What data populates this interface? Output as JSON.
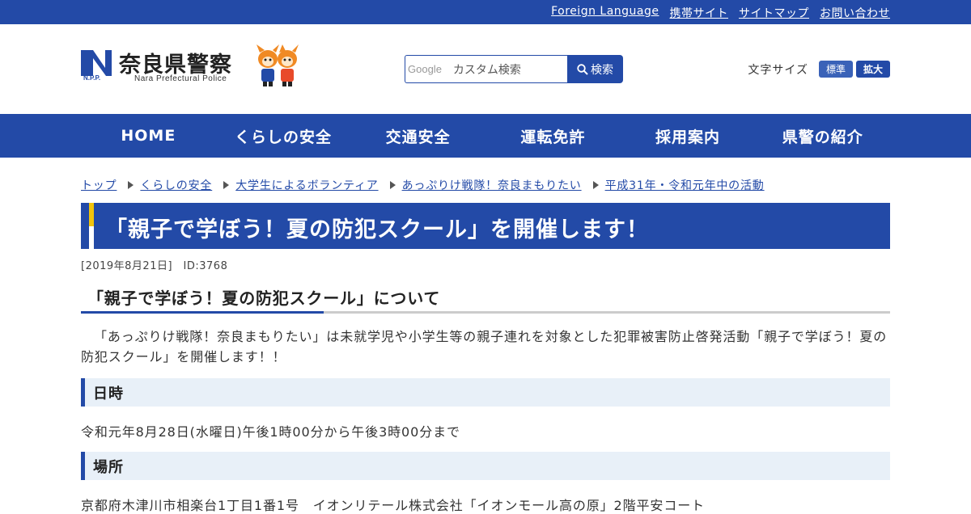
{
  "topbar": {
    "links": [
      "Foreign Language",
      "携帯サイト",
      "サイトマップ",
      "お問い合わせ"
    ]
  },
  "header": {
    "logo_title": "奈良県警察",
    "logo_sub": "Nara Prefectural Police",
    "logo_abbr": "N.P.P.",
    "search": {
      "brand": "Google",
      "placeholder": "カスタム検索",
      "button": "検索"
    },
    "fontsize": {
      "label": "文字サイズ",
      "standard": "標準",
      "large": "拡大"
    }
  },
  "nav": [
    "HOME",
    "くらしの安全",
    "交通安全",
    "運転免許",
    "採用案内",
    "県警の紹介"
  ],
  "breadcrumb": [
    "トップ",
    "くらしの安全",
    "大学生によるボランティア",
    "あっぷりけ戦隊！奈良まもりたい",
    "平成31年・令和元年中の活動"
  ],
  "page": {
    "title": "「親子で学ぼう！夏の防犯スクール」を開催します！",
    "meta": "[2019年8月21日]　ID:3768",
    "section_title": "「親子で学ぼう！夏の防犯スクール」について",
    "intro": "「あっぷりけ戦隊！奈良まもりたい」は未就学児や小学生等の親子連れを対象とした犯罪被害防止啓発活動「親子で学ぼう！夏の防犯スクール」を開催します！！",
    "date_heading": "日時",
    "date_text": "令和元年8月28日(水曜日)午後1時00分から午後3時00分まで",
    "place_heading": "場所",
    "place_text": "京都府木津川市相楽台1丁目1番1号　イオンリテール株式会社「イオンモール高の原」2階平安コート"
  },
  "colors": {
    "brand": "#234aa7",
    "accent": "#f2c40c",
    "section_bg": "#e8f0f8"
  }
}
